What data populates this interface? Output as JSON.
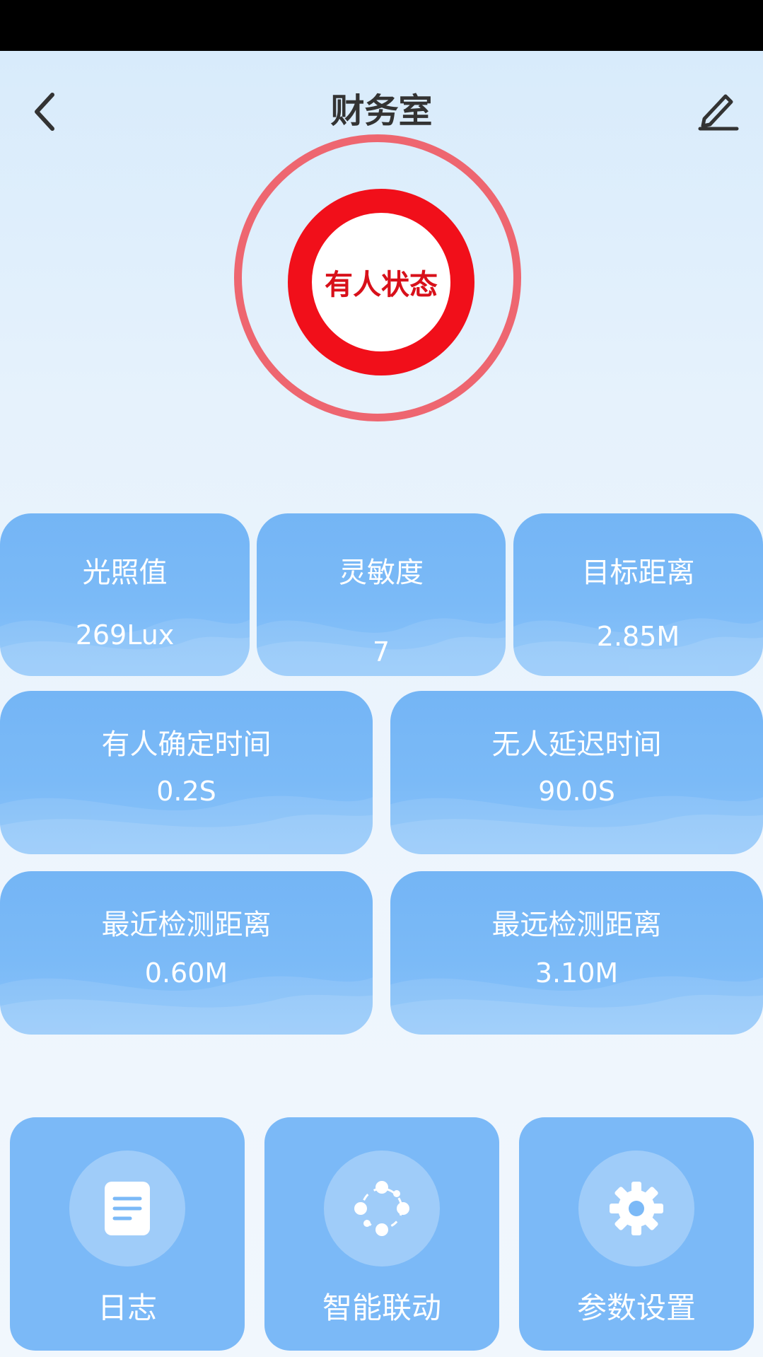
{
  "header": {
    "title": "财务室"
  },
  "status": {
    "label": "有人状态",
    "outer_color": "#ee6670",
    "inner_color": "#f10f1a"
  },
  "metrics_row1": [
    {
      "label": "光照值",
      "value": "269Lux"
    },
    {
      "label": "灵敏度",
      "value": "7"
    },
    {
      "label": "目标距离",
      "value": "2.85M"
    }
  ],
  "metrics_row2": [
    {
      "label": "有人确定时间",
      "value": "0.2S"
    },
    {
      "label": "无人延迟时间",
      "value": "90.0S"
    }
  ],
  "metrics_row3": [
    {
      "label": "最近检测距离",
      "value": "0.60M"
    },
    {
      "label": "最远检测距离",
      "value": "3.10M"
    }
  ],
  "actions": [
    {
      "label": "日志",
      "icon": "document-icon"
    },
    {
      "label": "智能联动",
      "icon": "linkage-icon"
    },
    {
      "label": "参数设置",
      "icon": "gear-icon"
    }
  ],
  "colors": {
    "card_blue": "#7bb9f7",
    "background": "#e6f2fc"
  }
}
